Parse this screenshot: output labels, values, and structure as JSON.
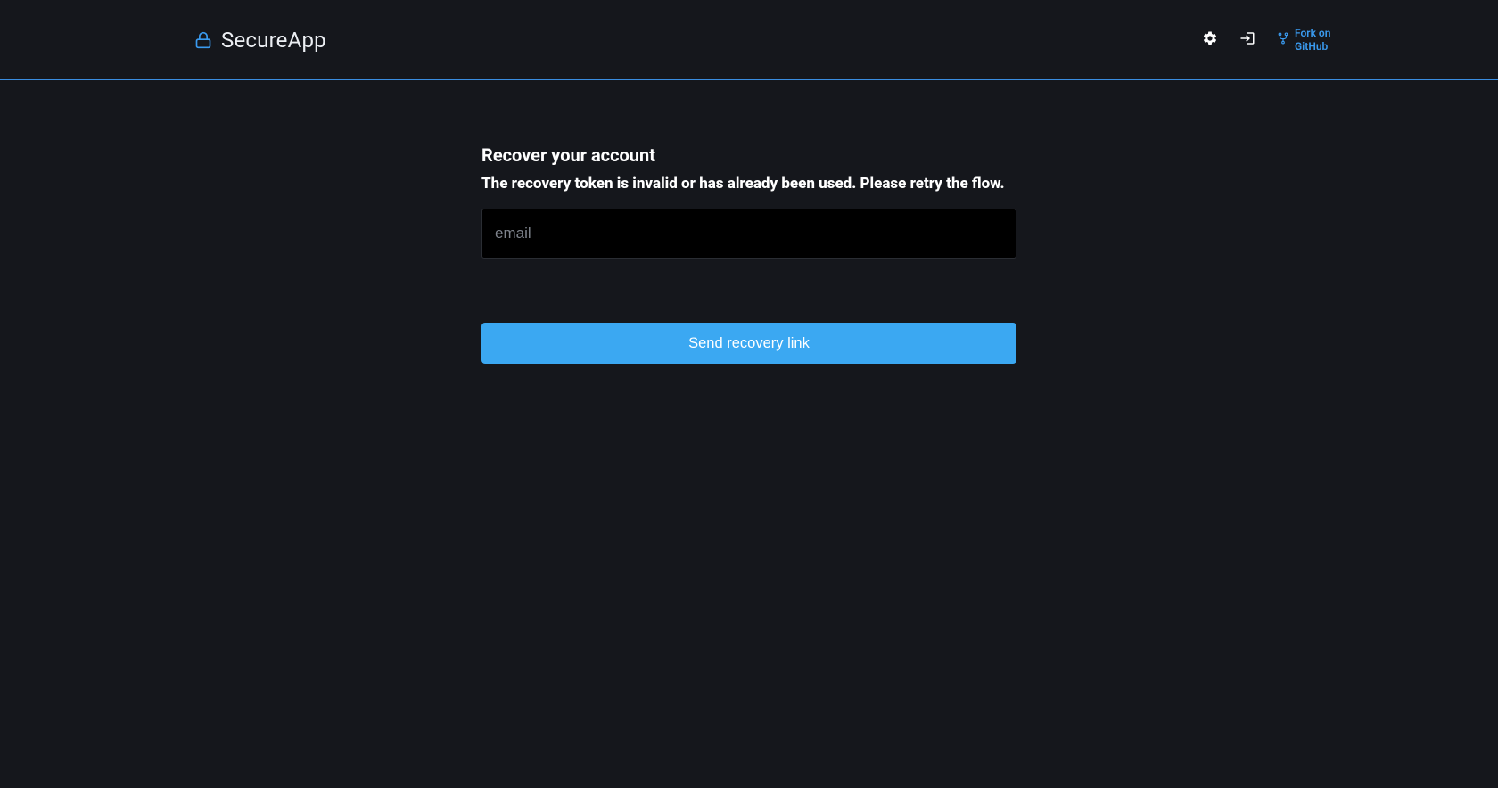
{
  "brand": {
    "name": "SecureApp"
  },
  "nav": {
    "fork_label": "Fork on GitHub"
  },
  "recovery": {
    "title": "Recover your account",
    "error": "The recovery token is invalid or has already been used. Please retry the flow.",
    "email_placeholder": "email",
    "submit_label": "Send recovery link"
  }
}
